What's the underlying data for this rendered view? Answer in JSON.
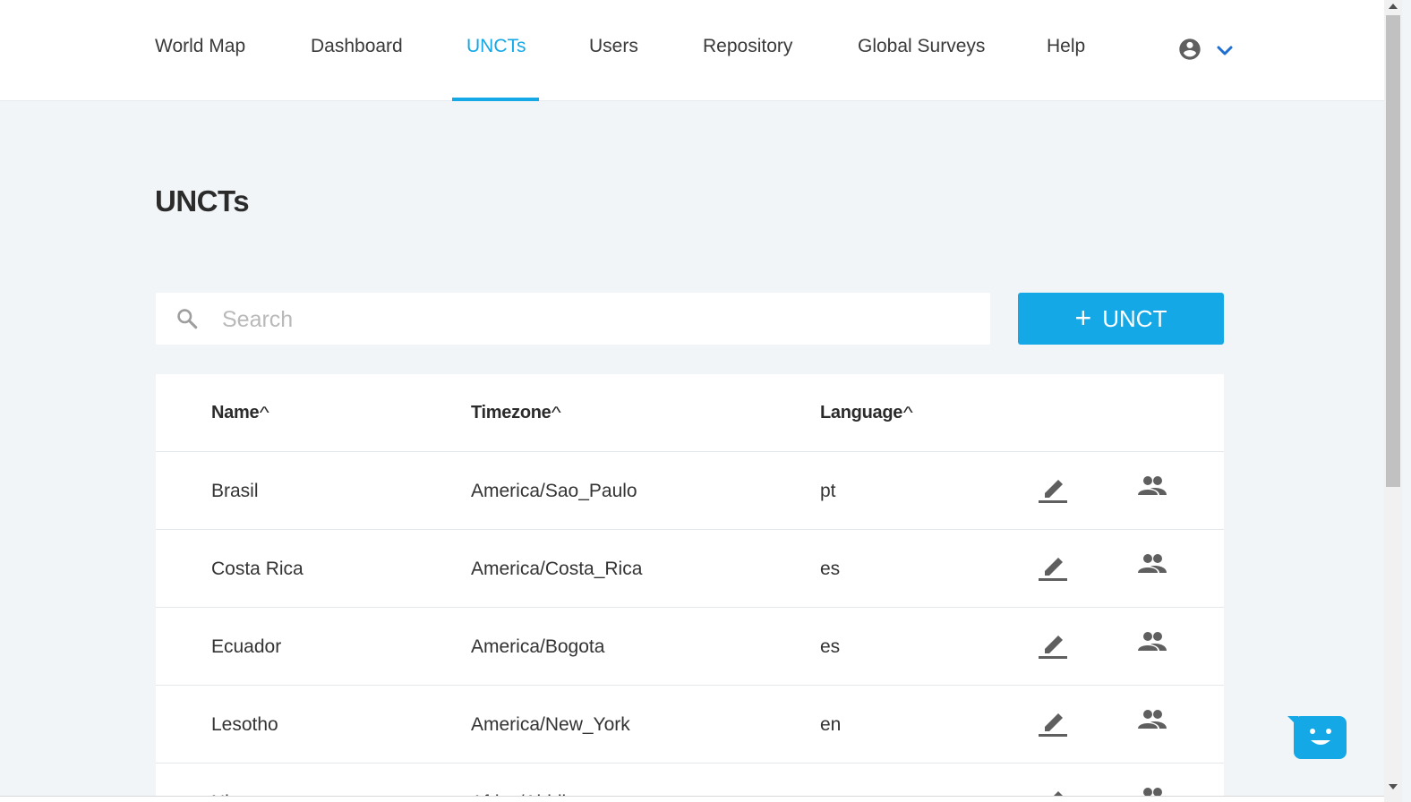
{
  "nav": {
    "items": [
      {
        "label": "World Map"
      },
      {
        "label": "Dashboard"
      },
      {
        "label": "UNCTs"
      },
      {
        "label": "Users"
      },
      {
        "label": "Repository"
      },
      {
        "label": "Global Surveys"
      },
      {
        "label": "Help"
      }
    ],
    "active_index": 2,
    "account_icon": "account-circle-icon",
    "menu_icon": "chevron-down-icon"
  },
  "page": {
    "title": "UNCTs"
  },
  "search": {
    "placeholder": "Search",
    "value": ""
  },
  "add_button": {
    "icon": "plus",
    "label": "UNCT"
  },
  "table": {
    "columns": [
      {
        "label": "Name",
        "sort_icon": "^"
      },
      {
        "label": "Timezone",
        "sort_icon": "^"
      },
      {
        "label": "Language",
        "sort_icon": "^"
      }
    ],
    "rows": [
      {
        "name": "Brasil",
        "timezone": "America/Sao_Paulo",
        "language": "pt"
      },
      {
        "name": "Costa Rica",
        "timezone": "America/Costa_Rica",
        "language": "es"
      },
      {
        "name": "Ecuador",
        "timezone": "America/Bogota",
        "language": "es"
      },
      {
        "name": "Lesotho",
        "timezone": "America/New_York",
        "language": "en"
      },
      {
        "name": "Ni...",
        "timezone": "Africa/Abidj...",
        "language": ""
      }
    ],
    "row_action_icons": [
      "edit-icon",
      "users-icon"
    ]
  },
  "colors": {
    "accent": "#14a9e6",
    "background": "#f1f5f8",
    "icon": "#5f5f5f"
  }
}
